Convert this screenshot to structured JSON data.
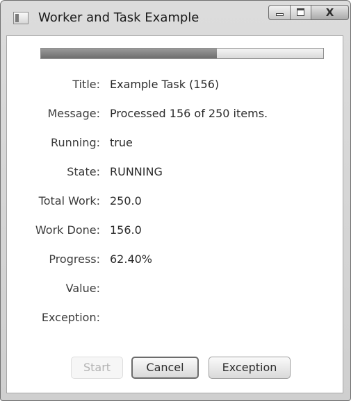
{
  "window": {
    "title": "Worker and Task Example",
    "controls": {
      "minimize": "minimize-icon",
      "maximize": "maximize-icon",
      "close": "close-icon",
      "close_glyph": "X"
    }
  },
  "progress": {
    "fraction": 0.624
  },
  "fields": [
    {
      "label": "Title:",
      "value": "Example Task (156)"
    },
    {
      "label": "Message:",
      "value": "Processed 156 of 250 items."
    },
    {
      "label": "Running:",
      "value": "true"
    },
    {
      "label": "State:",
      "value": "RUNNING"
    },
    {
      "label": "Total Work:",
      "value": "250.0"
    },
    {
      "label": "Work Done:",
      "value": "156.0"
    },
    {
      "label": "Progress:",
      "value": "62.40%"
    },
    {
      "label": "Value:",
      "value": ""
    },
    {
      "label": "Exception:",
      "value": ""
    }
  ],
  "buttons": {
    "start": "Start",
    "cancel": "Cancel",
    "exception": "Exception"
  },
  "colors": {
    "progress_fill": "#7f7f7f",
    "disabled_text": "#b2b2b2"
  }
}
